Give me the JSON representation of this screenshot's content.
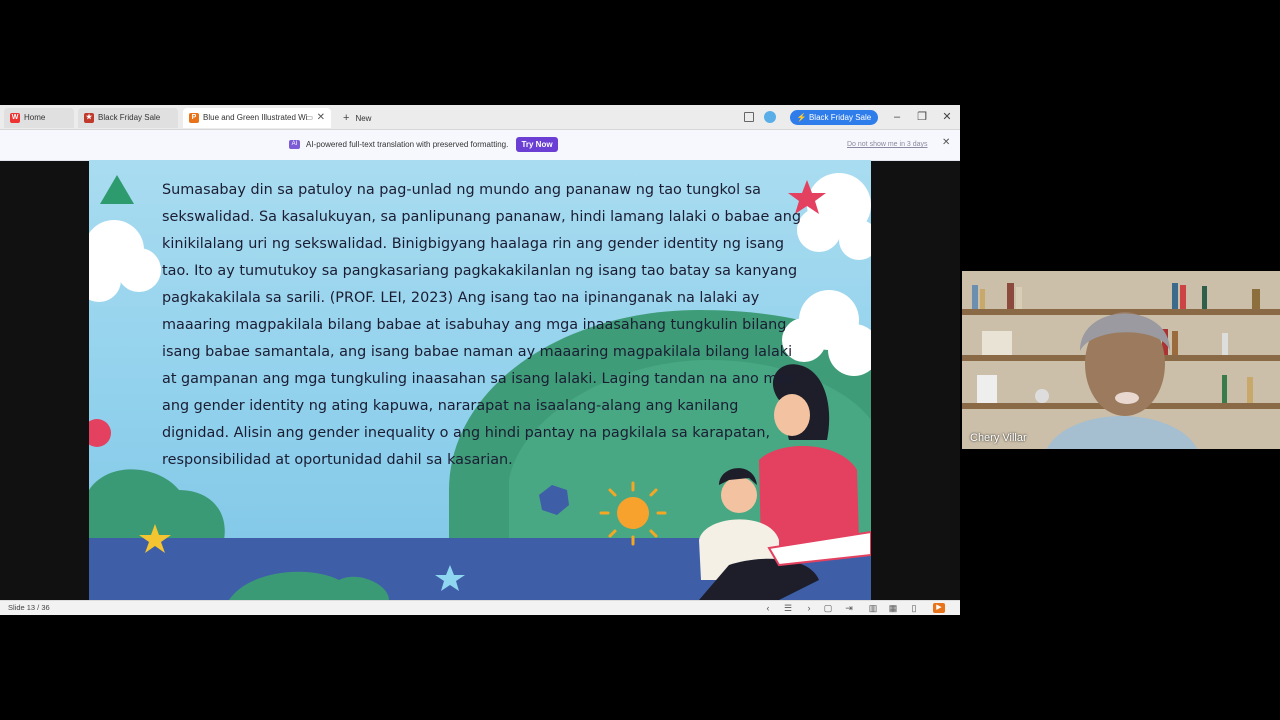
{
  "tabs": [
    {
      "label": "Home",
      "icon": "wps-logo-icon"
    },
    {
      "label": "Black Friday Sale",
      "icon": "black-friday-icon"
    },
    {
      "label": "Blue and Green Illustrated Wi",
      "icon": "presentation-icon"
    },
    {
      "label": "New",
      "icon": "plus-icon"
    }
  ],
  "toolbar": {
    "black_friday_button": "Black Friday Sale"
  },
  "notice": {
    "message": "AI-powered full-text translation with preserved formatting.",
    "try_button": "Try Now",
    "dismiss_link": "Do not show me in 3 days"
  },
  "slide": {
    "text": "Sumasabay din sa patuloy na pag-unlad ng mundo ang pananaw ng tao tungkol sa sekswalidad. Sa kasalukuyan, sa panlipunang pananaw, hindi lamang lalaki o babae ang kinikilalang uri ng sekswalidad. Binigbigyang haalaga rin ang gender identity ng isang tao. Ito ay tumutukoy sa pangkasariang pagkakakilanlan ng isang tao batay sa kanyang pagkakakilala sa sarili. (PROF. LEI, 2023) Ang isang tao na ipinanganak na lalaki ay maaaring magpakilala bilang babae at isabuhay ang mga inaasahang tungkulin bilang isang babae samantala, ang isang babae naman ay maaaring magpakilala bilang lalaki at gampanan ang mga tungkuling inaasahan sa isang lalaki. Laging tandan na ano man ang gender identity ng ating kapuwa, nararapat na isaalang-alang ang kanilang dignidad. Alisin ang gender inequality o ang hindi pantay na pagkilala sa karapatan, responsibilidad at oportunidad dahil sa kasarian."
  },
  "status": {
    "slide_indicator": "Slide 13 / 36"
  },
  "video": {
    "participant_name": "Chery Villar"
  },
  "colors": {
    "accent_blue": "#2f7dea",
    "try_now_purple": "#6b3fd4",
    "slide_sky": "#8fd0ec",
    "slide_ground": "#3f5ea8",
    "play_orange": "#e8731a"
  }
}
